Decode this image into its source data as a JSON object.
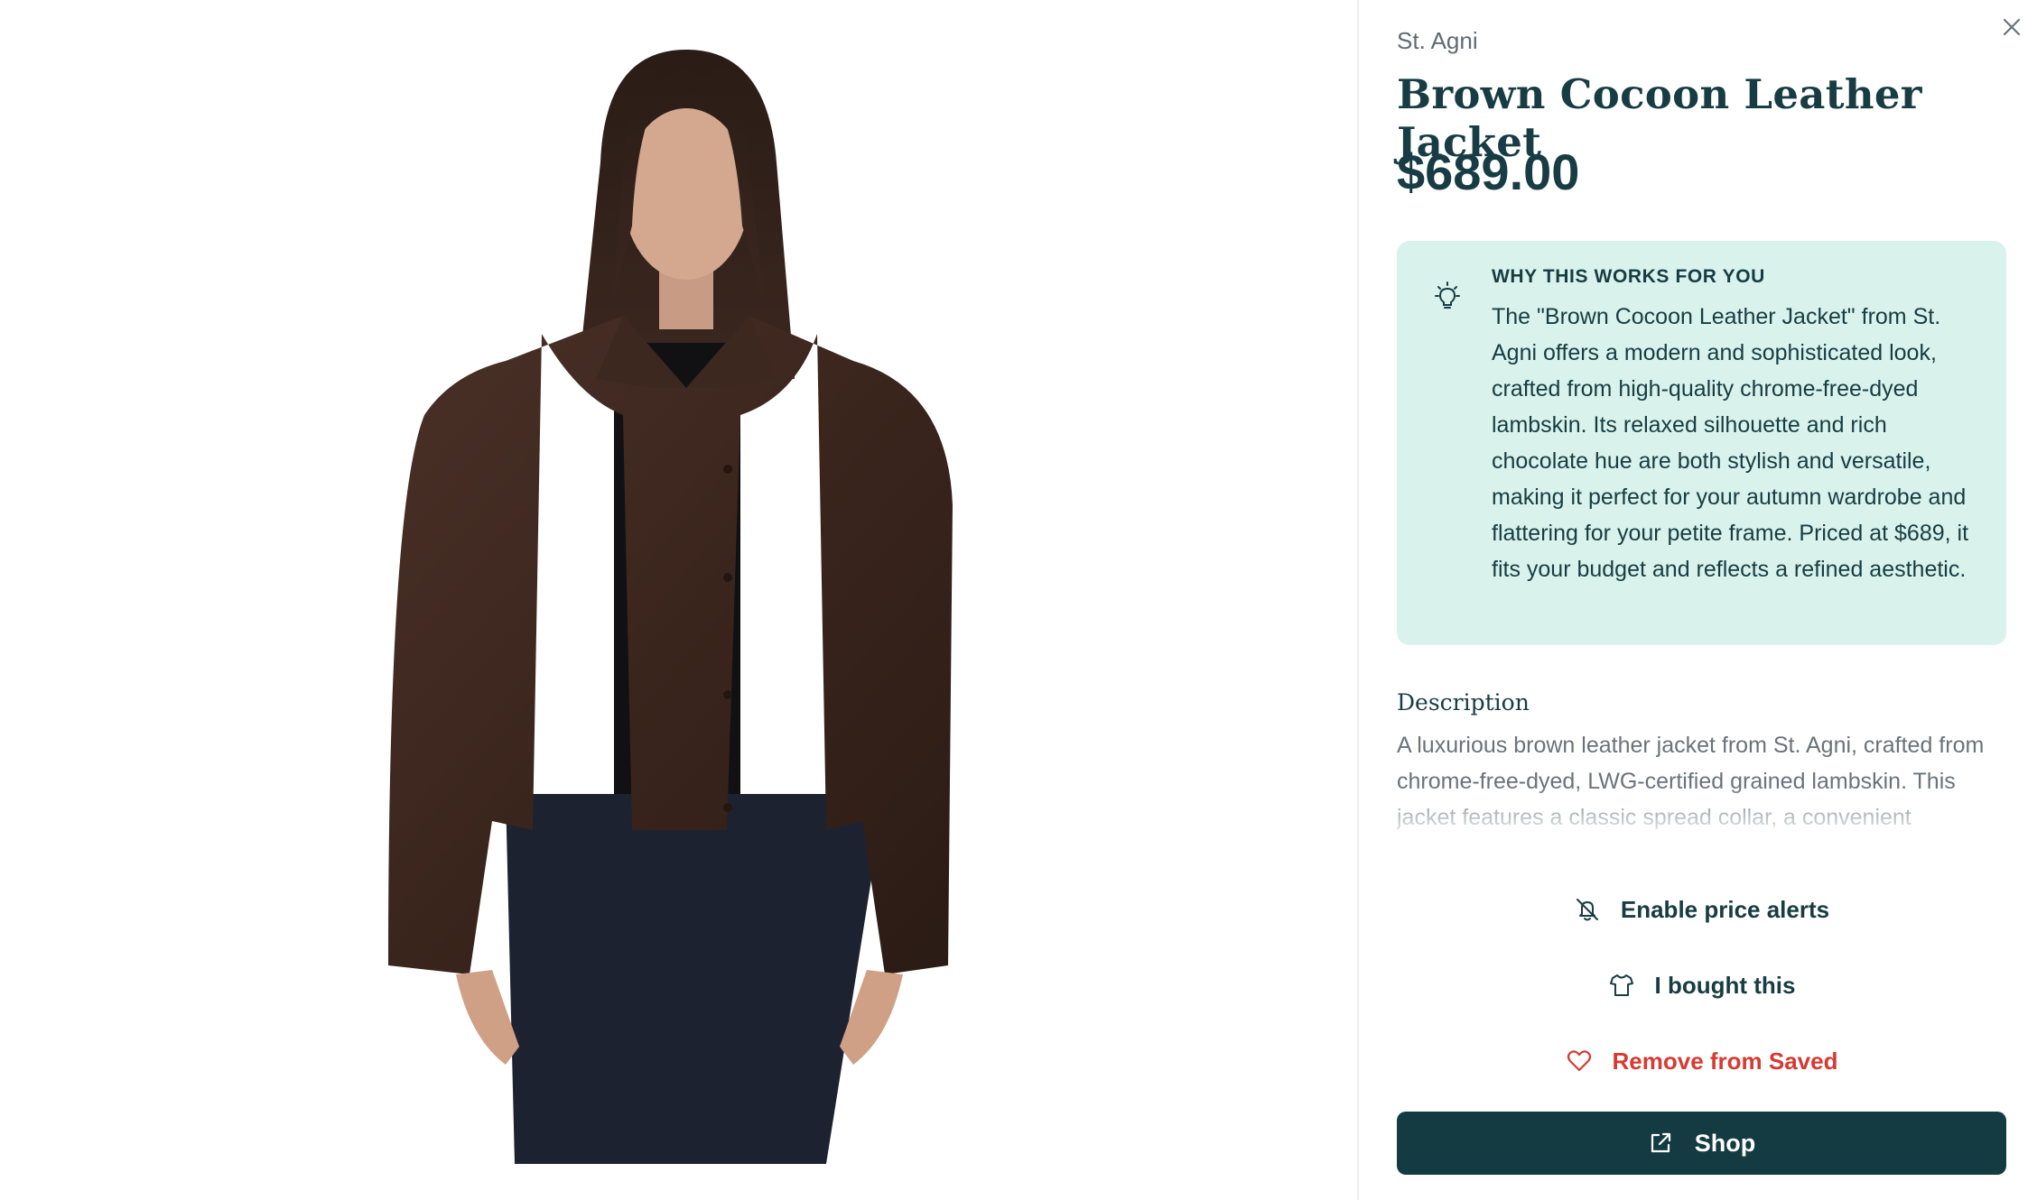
{
  "product": {
    "brand": "St. Agni",
    "title": "Brown Cocoon Leather Jacket",
    "price": "$689.00",
    "image_icon": "product-photo"
  },
  "why": {
    "heading": "WHY THIS WORKS FOR YOU",
    "text": "The \"Brown Cocoon Leather Jacket\" from St. Agni offers a modern and sophisticated look, crafted from high-quality chrome-free-dyed lambskin. Its relaxed silhouette and rich chocolate hue are both stylish and versatile, making it perfect for your autumn wardrobe and flattering for your petite frame. Priced at $689, it fits your budget and reflects a refined aesthetic.",
    "icon": "lightbulb-icon"
  },
  "description": {
    "heading": "Description",
    "text": "A luxurious brown leather jacket from St. Agni, crafted from chrome-free-dyed, LWG-certified grained lambskin. This jacket features a classic spread collar, a convenient"
  },
  "actions": {
    "price_alerts": "Enable price alerts",
    "bought": "I bought this",
    "remove_saved": "Remove from Saved",
    "shop": "Shop"
  },
  "colors": {
    "primary": "#143b42",
    "why_bg": "#d9f3ec",
    "danger": "#d63a33",
    "muted_text": "#6a737a"
  }
}
